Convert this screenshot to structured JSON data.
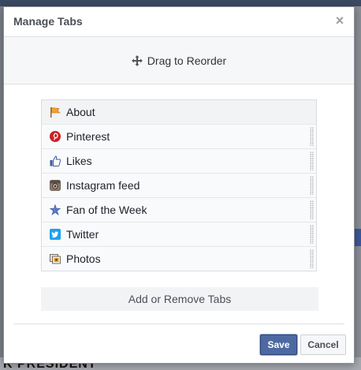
{
  "dialog": {
    "title": "Manage Tabs",
    "close_label": "×",
    "reorder_label": "Drag to Reorder",
    "tabs": [
      {
        "label": "About",
        "icon": "flag-icon"
      },
      {
        "label": "Pinterest",
        "icon": "pinterest-icon"
      },
      {
        "label": "Likes",
        "icon": "thumbs-up-icon"
      },
      {
        "label": "Instagram feed",
        "icon": "instagram-icon"
      },
      {
        "label": "Fan of the Week",
        "icon": "star-icon"
      },
      {
        "label": "Twitter",
        "icon": "twitter-icon"
      },
      {
        "label": "Photos",
        "icon": "photos-icon"
      }
    ],
    "add_remove_label": "Add or Remove Tabs",
    "save_label": "Save",
    "cancel_label": "Cancel"
  },
  "background": {
    "bottom_text": "K PRESIDENT"
  },
  "colors": {
    "accent": "#4e69a2",
    "pinterest": "#cb2027",
    "twitter": "#1da1f2",
    "facebook": "#3b5998"
  }
}
